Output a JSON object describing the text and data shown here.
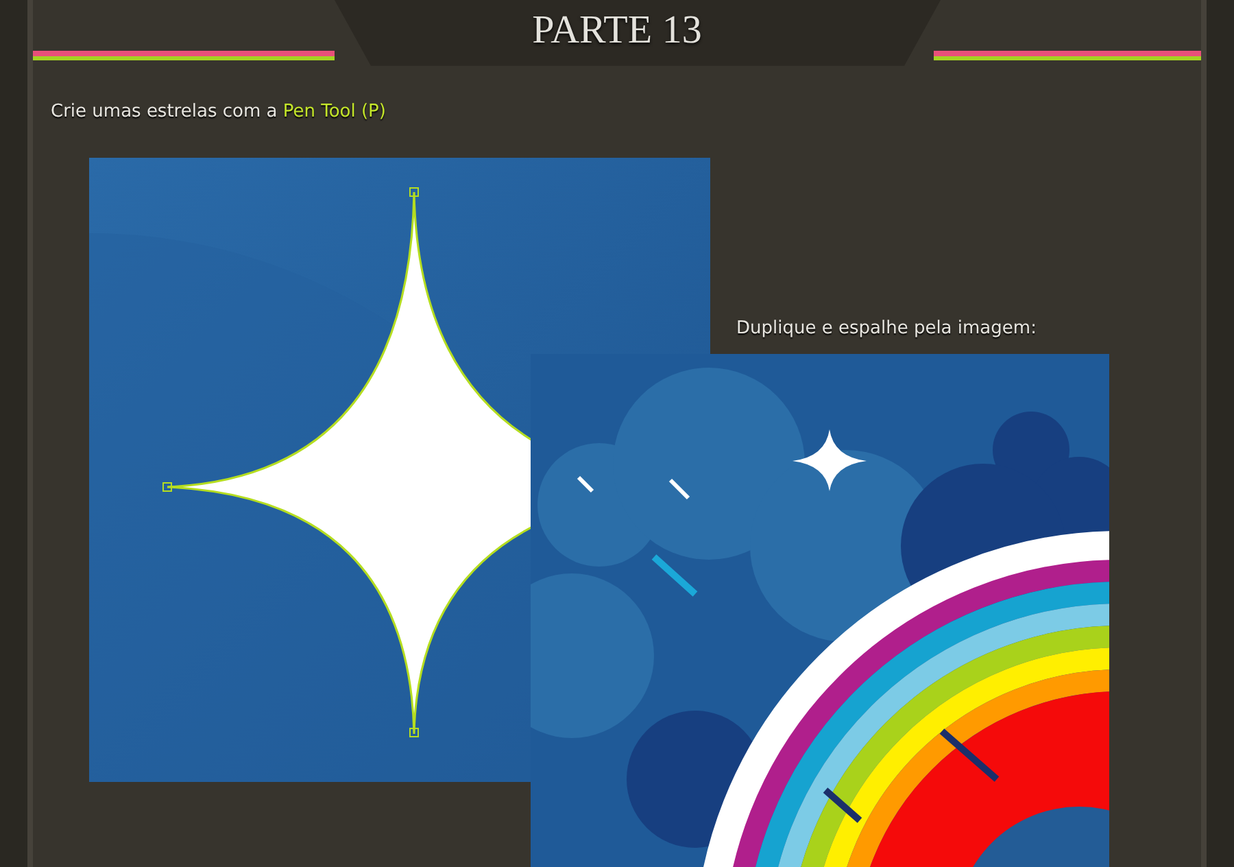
{
  "header": {
    "title": "PARTE 13"
  },
  "instruction": {
    "text": "Crie umas estrelas com a ",
    "highlight": "Pen Tool (P)"
  },
  "caption": "Duplique e espalhe pela imagem:"
}
